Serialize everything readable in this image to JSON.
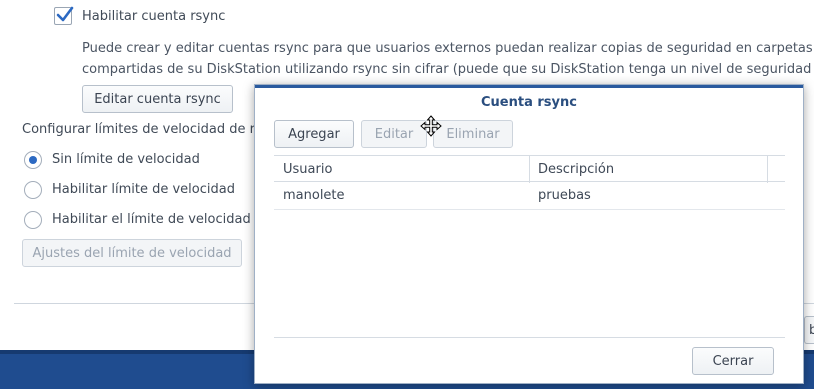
{
  "settings": {
    "enable_rsync_label": "Habilitar cuenta rsync",
    "enable_rsync_checked": true,
    "description_line1": "Puede crear y editar cuentas rsync para que usuarios externos puedan realizar copias de seguridad en carpetas",
    "description_line2": "compartidas de su DiskStation utilizando rsync sin cifrar (puede que su DiskStation tenga un nivel de seguridad más",
    "edit_account_button": "Editar cuenta rsync",
    "speed_limit_heading": "Configurar límites de velocidad de rsy",
    "speed_options": [
      {
        "label": "Sin límite de velocidad",
        "selected": true
      },
      {
        "label": "Habilitar límite de velocidad",
        "selected": false
      },
      {
        "label": "Habilitar el límite de velocidad de",
        "selected": false
      }
    ],
    "speed_settings_button": "Ajustes del límite de velocidad",
    "edge_button_partial": "b"
  },
  "dialog": {
    "title": "Cuenta rsync",
    "toolbar": {
      "add": "Agregar",
      "edit": "Editar",
      "delete": "Eliminar"
    },
    "columns": [
      "Usuario",
      "Descripción"
    ],
    "rows": [
      {
        "user": "manolete",
        "description": "pruebas"
      }
    ],
    "close_button": "Cerrar"
  },
  "colors": {
    "accent": "#2c69c2",
    "title": "#2a4e7f",
    "taskbar": "#1f4c8f"
  }
}
